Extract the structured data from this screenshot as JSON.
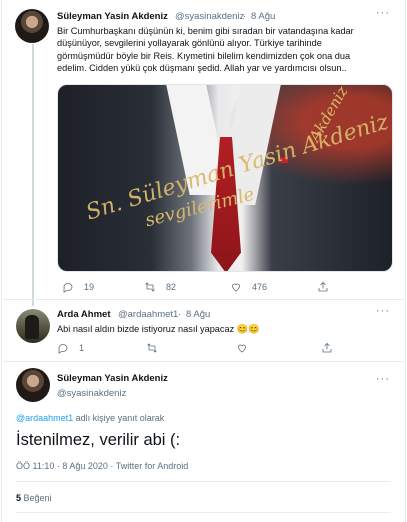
{
  "tweet1": {
    "name": "Süleyman Yasin Akdeniz",
    "handle": "@syasinakdeniz",
    "dot": "·",
    "time": "8 Ağu",
    "lines": [
      "Bir Cumhurbaşkanı düşünün ki, benim gibi sıradan bir vatandaşına kadar",
      "düşünüyor, sevgilerini yollayarak gönlünü alıyor. Türkiye tarihinde",
      "görmüşmüdür böyle bir Reis. Kıymetini bilelim kendimizden çok ona dua",
      "edelim. Cidden yükü çok düşmanı şedid. Allah yar ve yardımcısı olsun.."
    ],
    "image_text": {
      "line1": "Sn. Süleyman Yasin Akdeniz",
      "line2": "sevgilerimle",
      "line3": "Akdeniz"
    },
    "actions": {
      "replies": "19",
      "retweets": "82",
      "likes": "476"
    }
  },
  "tweet2": {
    "name": "Arda Ahmet",
    "handle": "@ardaahmet1",
    "dot": "·",
    "time": "8 Ağu",
    "text": "Abi nasıl aldın bizde istiyoruz nasıl yapacaz 😊😊",
    "actions": {
      "replies": "1"
    }
  },
  "tweet3": {
    "name": "Süleyman Yasin Akdeniz",
    "handle": "@syasinakdeniz",
    "reply_mention": "@ardaahmet1",
    "reply_suffix": " adlı kişiye yanıt olarak",
    "text": "İstenilmez, verilir abi (:",
    "timestamp": "ÖÖ 11:10 · 8 Ağu 2020",
    "dot": "·",
    "source": "Twitter for Android",
    "likes_count": "5",
    "likes_label": "Beğeni"
  },
  "icons": [
    "reply-icon",
    "retweet-icon",
    "like-icon",
    "share-icon",
    "more-icon"
  ],
  "colors": {
    "accent": "#1da1f2",
    "secondary_text": "#5b7083",
    "primary_text": "#0f1419",
    "divider": "#e6ecf0"
  }
}
